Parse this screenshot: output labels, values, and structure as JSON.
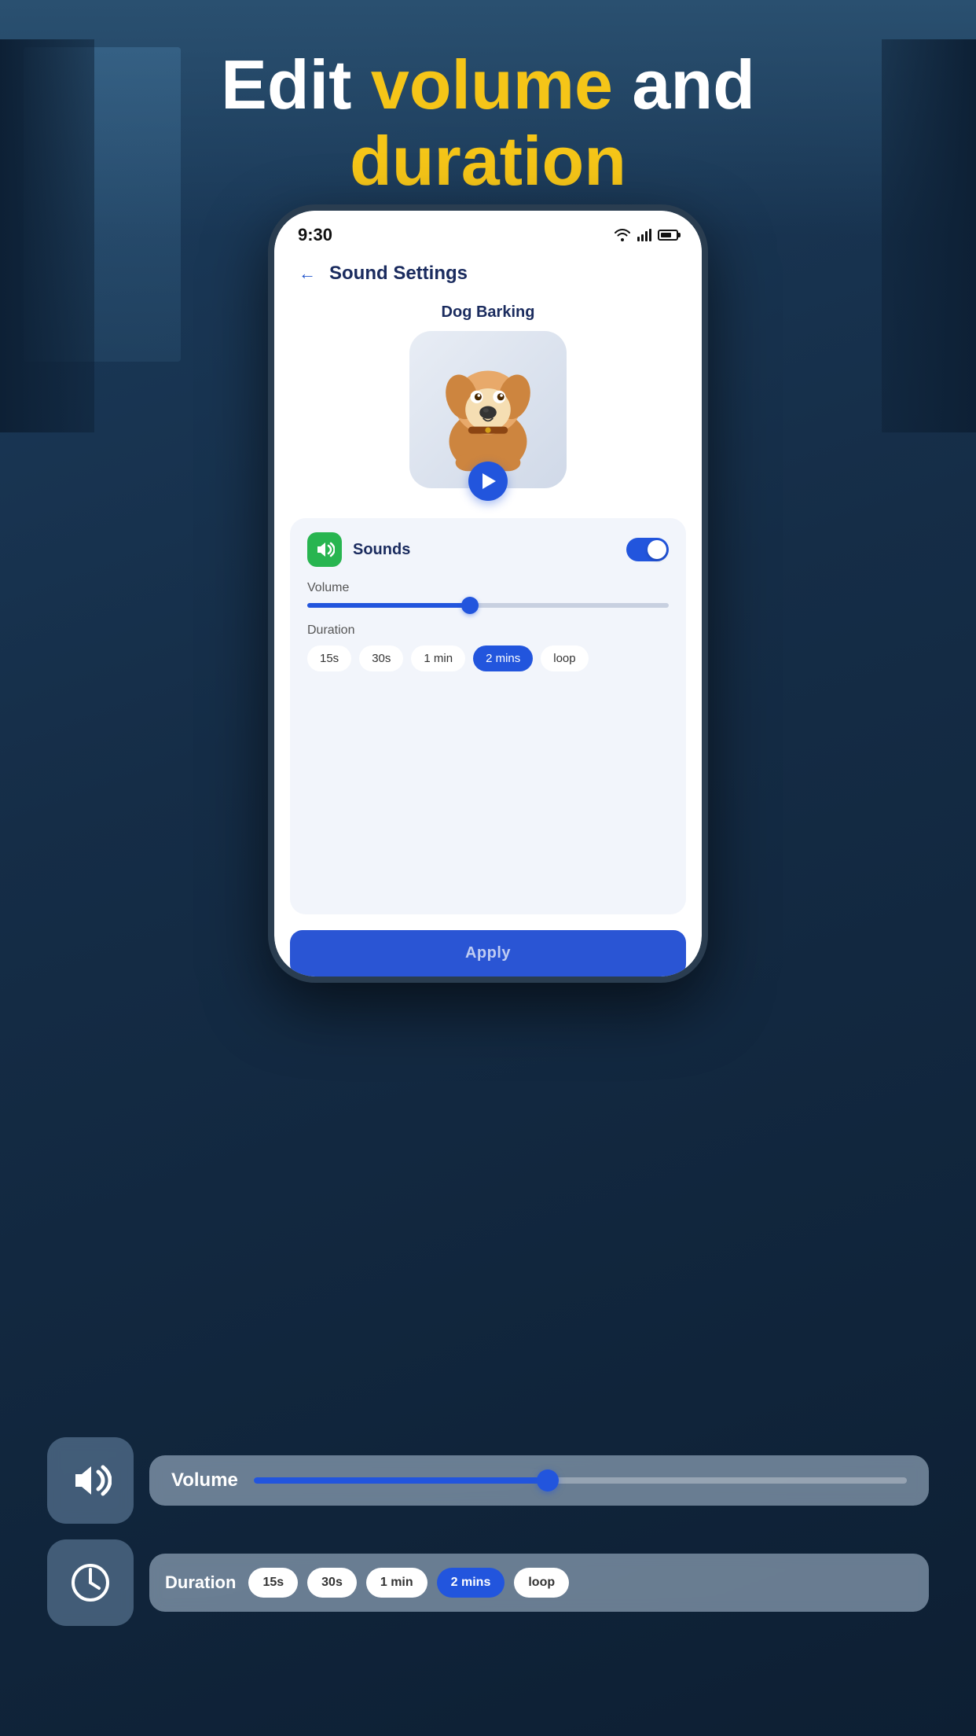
{
  "background": {
    "color": "#1a3a5c"
  },
  "header": {
    "line1_prefix": "Edit ",
    "line1_highlight": "volume",
    "line1_suffix": " and",
    "line2": "duration",
    "highlight_color": "#f5c518"
  },
  "phone": {
    "status_bar": {
      "time": "9:30",
      "wifi": true,
      "signal": true,
      "battery": true
    },
    "nav": {
      "back_label": "←",
      "title": "Sound Settings"
    },
    "sound": {
      "name": "Dog Barking",
      "play_button_label": "▶"
    },
    "settings": {
      "sounds_label": "Sounds",
      "toggle_on": true,
      "volume_label": "Volume",
      "volume_percent": 45,
      "duration_label": "Duration",
      "duration_options": [
        "15s",
        "30s",
        "1 min",
        "2 mins",
        "loop"
      ],
      "duration_active": "2 mins",
      "apply_label": "Apply"
    }
  },
  "bottom_controls": {
    "volume_label": "Volume",
    "volume_percent": 45,
    "duration_label": "Duration",
    "duration_options": [
      "15s",
      "30s",
      "1 min",
      "2 mins",
      "loop"
    ],
    "duration_active": "2 mins"
  }
}
